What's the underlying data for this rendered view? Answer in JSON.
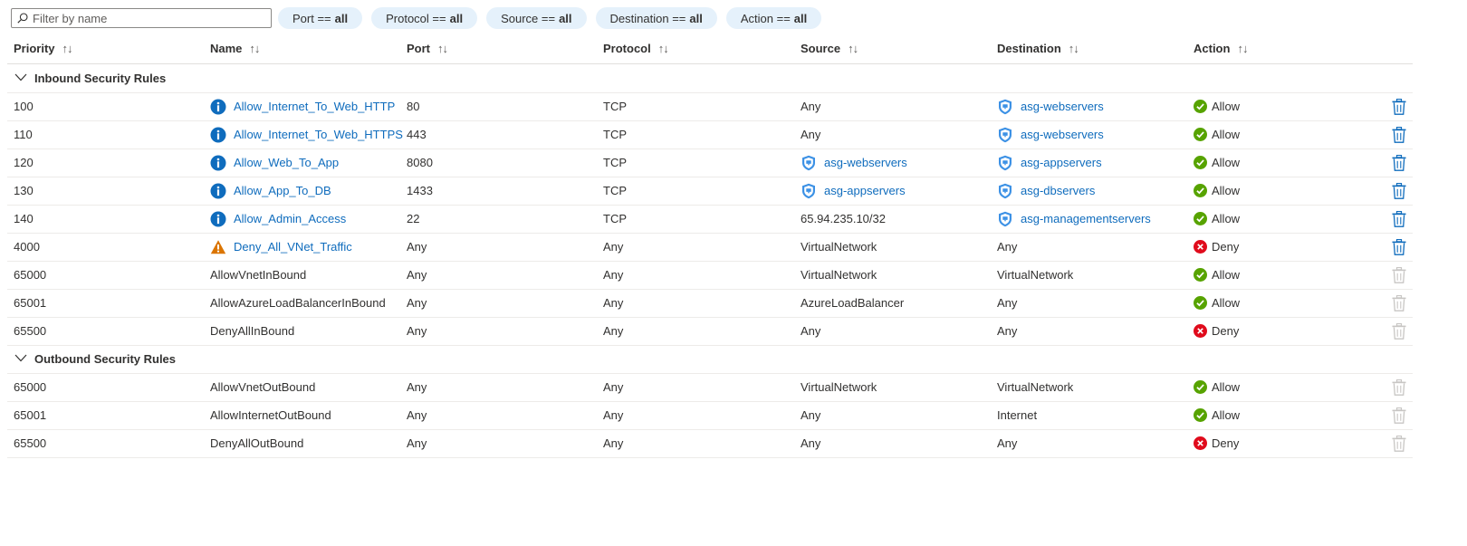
{
  "filter": {
    "placeholder": "Filter by name"
  },
  "pills": [
    {
      "label": "Port ==",
      "value": "all"
    },
    {
      "label": "Protocol ==",
      "value": "all"
    },
    {
      "label": "Source ==",
      "value": "all"
    },
    {
      "label": "Destination ==",
      "value": "all"
    },
    {
      "label": "Action ==",
      "value": "all"
    }
  ],
  "columns": [
    "Priority",
    "Name",
    "Port",
    "Protocol",
    "Source",
    "Destination",
    "Action"
  ],
  "sort_glyph": "↑↓",
  "groups": {
    "inbound": "Inbound Security Rules",
    "outbound": "Outbound Security Rules"
  },
  "inbound_rules": [
    {
      "priority": "100",
      "name": "Allow_Internet_To_Web_HTTP",
      "name_icon": "info-icon",
      "port": "80",
      "protocol": "TCP",
      "source": "Any",
      "source_asg": false,
      "destination": "asg-webservers",
      "destination_asg": true,
      "action": "Allow",
      "deletable": true
    },
    {
      "priority": "110",
      "name": "Allow_Internet_To_Web_HTTPS",
      "name_icon": "info-icon",
      "port": "443",
      "protocol": "TCP",
      "source": "Any",
      "source_asg": false,
      "destination": "asg-webservers",
      "destination_asg": true,
      "action": "Allow",
      "deletable": true
    },
    {
      "priority": "120",
      "name": "Allow_Web_To_App",
      "name_icon": "info-icon",
      "port": "8080",
      "protocol": "TCP",
      "source": "asg-webservers",
      "source_asg": true,
      "destination": "asg-appservers",
      "destination_asg": true,
      "action": "Allow",
      "deletable": true
    },
    {
      "priority": "130",
      "name": "Allow_App_To_DB",
      "name_icon": "info-icon",
      "port": "1433",
      "protocol": "TCP",
      "source": "asg-appservers",
      "source_asg": true,
      "destination": "asg-dbservers",
      "destination_asg": true,
      "action": "Allow",
      "deletable": true
    },
    {
      "priority": "140",
      "name": "Allow_Admin_Access",
      "name_icon": "info-icon",
      "port": "22",
      "protocol": "TCP",
      "source": "65.94.235.10/32",
      "source_asg": false,
      "destination": "asg-managementservers",
      "destination_asg": true,
      "action": "Allow",
      "deletable": true
    },
    {
      "priority": "4000",
      "name": "Deny_All_VNet_Traffic",
      "name_icon": "warning-icon",
      "port": "Any",
      "protocol": "Any",
      "source": "VirtualNetwork",
      "source_asg": false,
      "destination": "Any",
      "destination_asg": false,
      "action": "Deny",
      "deletable": true
    },
    {
      "priority": "65000",
      "name": "AllowVnetInBound",
      "name_icon": "",
      "port": "Any",
      "protocol": "Any",
      "source": "VirtualNetwork",
      "source_asg": false,
      "destination": "VirtualNetwork",
      "destination_asg": false,
      "action": "Allow",
      "deletable": false
    },
    {
      "priority": "65001",
      "name": "AllowAzureLoadBalancerInBound",
      "name_icon": "",
      "port": "Any",
      "protocol": "Any",
      "source": "AzureLoadBalancer",
      "source_asg": false,
      "destination": "Any",
      "destination_asg": false,
      "action": "Allow",
      "deletable": false
    },
    {
      "priority": "65500",
      "name": "DenyAllInBound",
      "name_icon": "",
      "port": "Any",
      "protocol": "Any",
      "source": "Any",
      "source_asg": false,
      "destination": "Any",
      "destination_asg": false,
      "action": "Deny",
      "deletable": false
    }
  ],
  "outbound_rules": [
    {
      "priority": "65000",
      "name": "AllowVnetOutBound",
      "name_icon": "",
      "port": "Any",
      "protocol": "Any",
      "source": "VirtualNetwork",
      "source_asg": false,
      "destination": "VirtualNetwork",
      "destination_asg": false,
      "action": "Allow",
      "deletable": false
    },
    {
      "priority": "65001",
      "name": "AllowInternetOutBound",
      "name_icon": "",
      "port": "Any",
      "protocol": "Any",
      "source": "Any",
      "source_asg": false,
      "destination": "Internet",
      "destination_asg": false,
      "action": "Allow",
      "deletable": false
    },
    {
      "priority": "65500",
      "name": "DenyAllOutBound",
      "name_icon": "",
      "port": "Any",
      "protocol": "Any",
      "source": "Any",
      "source_asg": false,
      "destination": "Any",
      "destination_asg": false,
      "action": "Deny",
      "deletable": false
    }
  ],
  "colors": {
    "link": "#0f6cbd",
    "pill_bg": "#e5f1fb",
    "allow": "#57a300",
    "deny": "#e00b1c",
    "warning": "#db7500",
    "info": "#0f6cbd",
    "asg_shield": "#3c91e5",
    "delete_enabled": "#0f6cbd",
    "delete_disabled": "#c8c6c4"
  }
}
